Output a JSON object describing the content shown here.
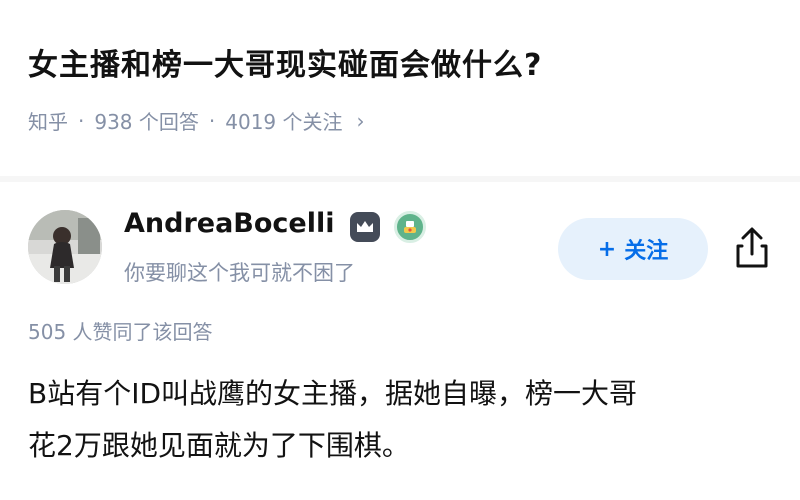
{
  "question": {
    "title": "女主播和榜一大哥现实碰面会做什么?",
    "source": "知乎",
    "answers_count": "938 个回答",
    "followers_count": "4019 个关注",
    "meta_separator": "·",
    "chevron": "›"
  },
  "answer": {
    "author": {
      "name": "AndreaBocelli",
      "bio": "你要聊这个我可就不困了",
      "badges": [
        "crown-badge-icon",
        "achievement-badge-icon"
      ]
    },
    "follow_button": {
      "label": "关注",
      "plus": "+"
    },
    "upvote_text": "505 人赞同了该回答",
    "content_lines": [
      "B站有个ID叫战鹰的女主播，据她自曝，榜一大哥",
      "花2万跟她见面就为了下围棋。"
    ]
  },
  "colors": {
    "accent": "#056de8",
    "follow_bg": "#e6f1fc",
    "meta_gray": "#8590a6",
    "text": "#121212"
  }
}
